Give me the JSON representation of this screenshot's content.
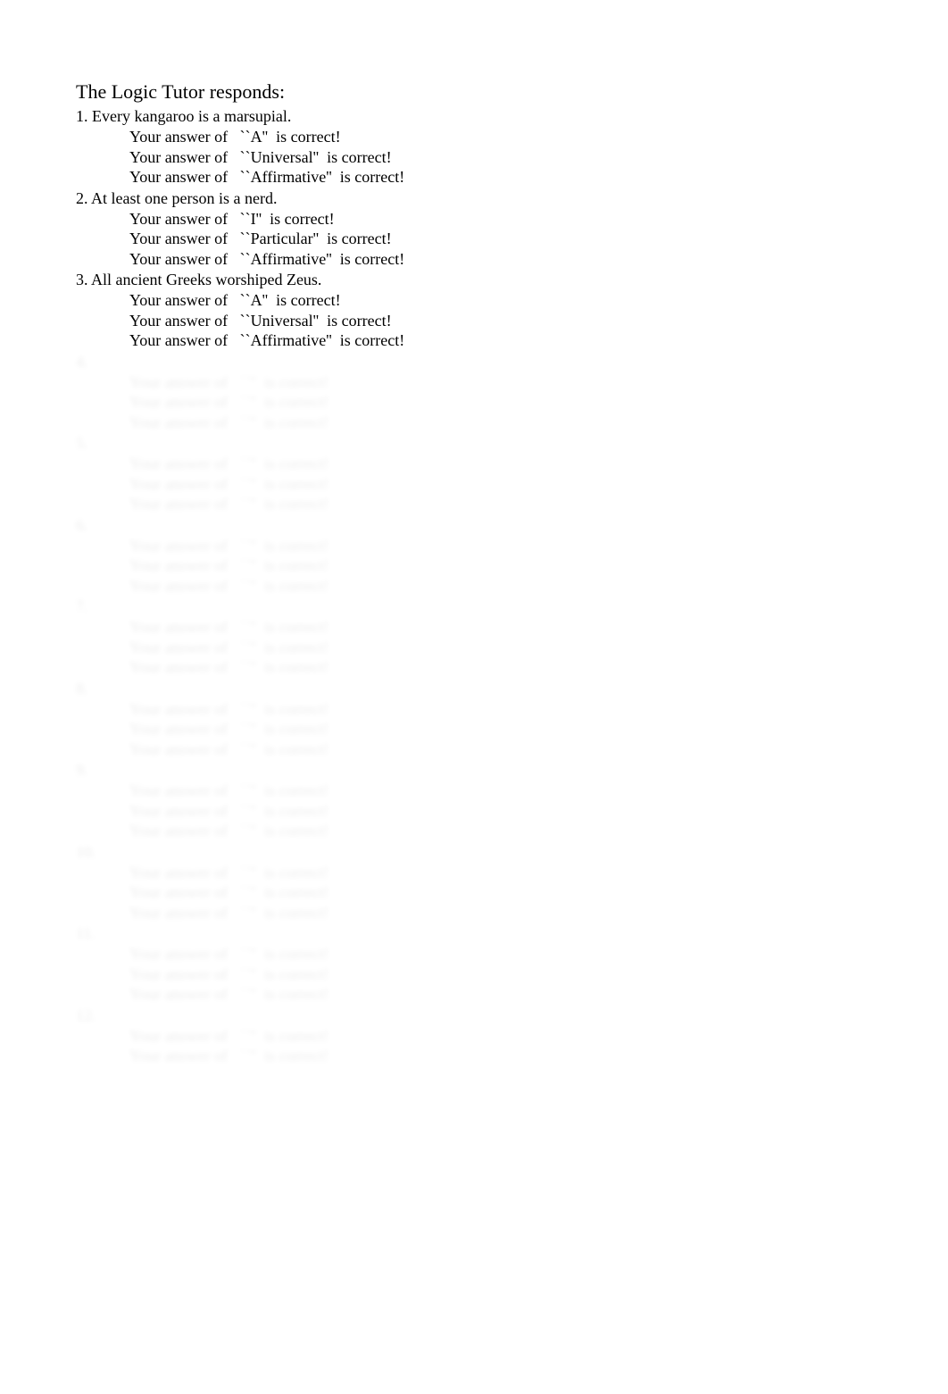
{
  "header": "The Logic Tutor responds:",
  "prefix": "Your answer of   ``",
  "suffix_correct": "''  is correct!",
  "items": [
    {
      "num": "1",
      "statement": "Every kangaroo is a marsupial.",
      "answers": [
        "A",
        "Universal",
        "Affirmative"
      ],
      "visible": true
    },
    {
      "num": "2",
      "statement": "At least one person is a nerd.",
      "answers": [
        "I",
        "Particular",
        "Affirmative"
      ],
      "visible": true
    },
    {
      "num": "3",
      "statement": "All ancient Greeks worshiped Zeus.",
      "answers": [
        "A",
        "Universal",
        "Affirmative"
      ],
      "visible": true
    },
    {
      "num": "4",
      "statement": "",
      "answers": [
        "",
        "",
        ""
      ],
      "visible": false
    },
    {
      "num": "5",
      "statement": "",
      "answers": [
        "",
        "",
        ""
      ],
      "visible": false
    },
    {
      "num": "6",
      "statement": "",
      "answers": [
        "",
        "",
        ""
      ],
      "visible": false
    },
    {
      "num": "7",
      "statement": "",
      "answers": [
        "",
        "",
        ""
      ],
      "visible": false
    },
    {
      "num": "8",
      "statement": "",
      "answers": [
        "",
        "",
        ""
      ],
      "visible": false
    },
    {
      "num": "9",
      "statement": "",
      "answers": [
        "",
        "",
        ""
      ],
      "visible": false
    },
    {
      "num": "10",
      "statement": "",
      "answers": [
        "",
        "",
        ""
      ],
      "visible": false
    },
    {
      "num": "11",
      "statement": "",
      "answers": [
        "",
        "",
        ""
      ],
      "visible": false
    },
    {
      "num": "12",
      "statement": "",
      "answers": [
        "",
        ""
      ],
      "visible": false
    }
  ]
}
